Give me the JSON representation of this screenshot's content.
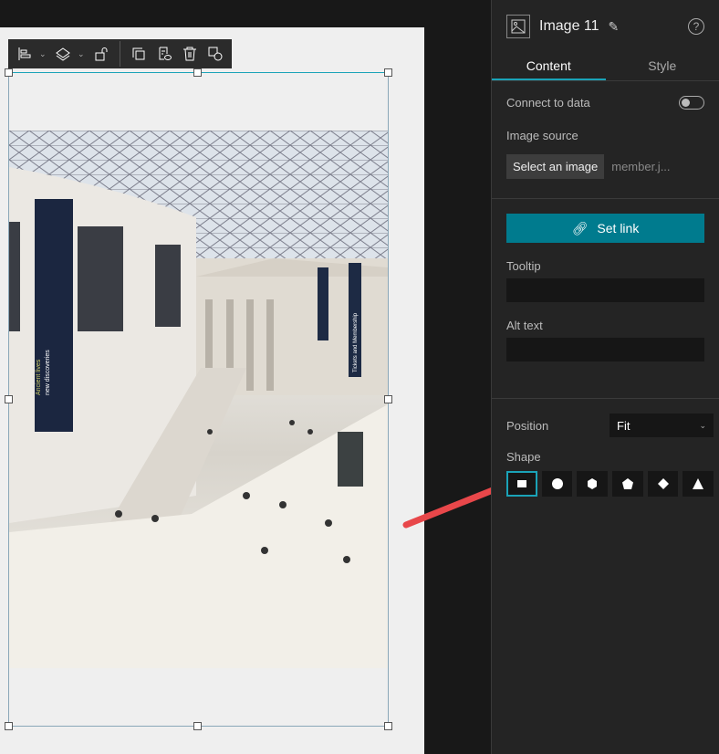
{
  "toolbar": {
    "items": [
      "align-icon",
      "layers-icon",
      "unlock-icon",
      "duplicate-icon",
      "edit-off-icon",
      "delete-icon",
      "shapes-icon"
    ]
  },
  "panel": {
    "title": "Image 11",
    "help": "?",
    "tabs": [
      {
        "label": "Content",
        "active": true
      },
      {
        "label": "Style",
        "active": false
      }
    ],
    "connect_label": "Connect to data",
    "connect_on": false,
    "image_source_label": "Image source",
    "select_image": "Select an image",
    "file_name": "member.j...",
    "set_link": "Set link",
    "tooltip_label": "Tooltip",
    "alt_label": "Alt text",
    "position_label": "Position",
    "position_value": "Fit",
    "shape_label": "Shape",
    "shapes": [
      "rectangle",
      "circle",
      "hexagon",
      "pentagon",
      "diamond",
      "triangle"
    ],
    "accent": "#007b8e",
    "arrow_color": "#e8474a"
  },
  "photo": {
    "banner1_l1": "Ancient lives",
    "banner1_l2": "new discoveries",
    "banner2": "Tickets and Membership"
  }
}
